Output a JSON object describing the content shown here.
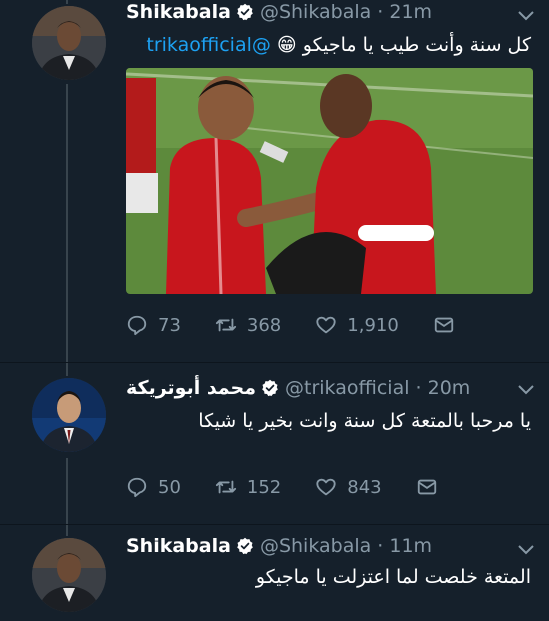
{
  "tweets": [
    {
      "name": "Shikabala",
      "handle": "@Shikabala · 21m",
      "text": "كل سنة وأنت طيب يا ماجيكو",
      "emoji": "😁",
      "mention": "@trikaofficial",
      "replies": "73",
      "retweets": "368",
      "likes": "1,910"
    },
    {
      "name": "محمد أبوتريكة",
      "handle": "@trikaofficial · 20m",
      "text": "يا مرحبا بالمتعة كل سنة وانت بخير يا شيكا",
      "replies": "50",
      "retweets": "152",
      "likes": "843"
    },
    {
      "name": "Shikabala",
      "handle": "@Shikabala · 11m",
      "text": "المتعة خلصت لما اعتزلت يا ماجيكو"
    }
  ],
  "icons": {
    "verified": "verified-badge-icon",
    "caret": "chevron-down-icon",
    "reply": "reply-icon",
    "retweet": "retweet-icon",
    "like": "heart-icon",
    "dm": "envelope-icon"
  },
  "colors": {
    "background": "#15202b",
    "secondary_text": "#8899a6",
    "link": "#1da1f2"
  }
}
